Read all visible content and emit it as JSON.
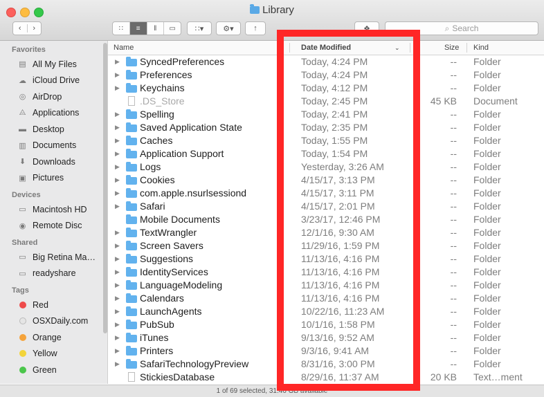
{
  "window": {
    "title": "Library"
  },
  "toolbar": {
    "search_placeholder": "Search",
    "view_icons": [
      "icon-view-icon",
      "list-view-icon",
      "column-view-icon",
      "cover-flow-icon"
    ]
  },
  "sidebar": {
    "sections": [
      {
        "title": "Favorites",
        "items": [
          {
            "label": "All My Files",
            "icon": "all-files-icon"
          },
          {
            "label": "iCloud Drive",
            "icon": "cloud-icon"
          },
          {
            "label": "AirDrop",
            "icon": "airdrop-icon"
          },
          {
            "label": "Applications",
            "icon": "applications-icon"
          },
          {
            "label": "Desktop",
            "icon": "desktop-icon"
          },
          {
            "label": "Documents",
            "icon": "documents-icon"
          },
          {
            "label": "Downloads",
            "icon": "downloads-icon"
          },
          {
            "label": "Pictures",
            "icon": "pictures-icon"
          }
        ]
      },
      {
        "title": "Devices",
        "items": [
          {
            "label": "Macintosh HD",
            "icon": "harddisk-icon"
          },
          {
            "label": "Remote Disc",
            "icon": "disc-icon"
          }
        ]
      },
      {
        "title": "Shared",
        "items": [
          {
            "label": "Big Retina Ma…",
            "icon": "display-icon"
          },
          {
            "label": "readyshare",
            "icon": "display-icon"
          }
        ]
      },
      {
        "title": "Tags",
        "items": [
          {
            "label": "Red",
            "color": "#ee4b4b"
          },
          {
            "label": "OSXDaily.com",
            "color": "#e5e5e5"
          },
          {
            "label": "Orange",
            "color": "#f5a33b"
          },
          {
            "label": "Yellow",
            "color": "#f3d43a"
          },
          {
            "label": "Green",
            "color": "#4bc64b"
          }
        ]
      }
    ]
  },
  "columns": {
    "name": "Name",
    "date": "Date Modified",
    "size": "Size",
    "kind": "Kind"
  },
  "files": [
    {
      "name": "SyncedPreferences",
      "date": "Today, 4:24 PM",
      "size": "--",
      "kind": "Folder",
      "folder": true,
      "expand": true
    },
    {
      "name": "Preferences",
      "date": "Today, 4:24 PM",
      "size": "--",
      "kind": "Folder",
      "folder": true,
      "expand": true
    },
    {
      "name": "Keychains",
      "date": "Today, 4:12 PM",
      "size": "--",
      "kind": "Folder",
      "folder": true,
      "expand": true
    },
    {
      "name": ".DS_Store",
      "date": "Today, 2:45 PM",
      "size": "45 KB",
      "kind": "Document",
      "folder": false,
      "expand": false,
      "dim": true
    },
    {
      "name": "Spelling",
      "date": "Today, 2:41 PM",
      "size": "--",
      "kind": "Folder",
      "folder": true,
      "expand": true
    },
    {
      "name": "Saved Application State",
      "date": "Today, 2:35 PM",
      "size": "--",
      "kind": "Folder",
      "folder": true,
      "expand": true
    },
    {
      "name": "Caches",
      "date": "Today, 1:55 PM",
      "size": "--",
      "kind": "Folder",
      "folder": true,
      "expand": true
    },
    {
      "name": "Application Support",
      "date": "Today, 1:54 PM",
      "size": "--",
      "kind": "Folder",
      "folder": true,
      "expand": true
    },
    {
      "name": "Logs",
      "date": "Yesterday, 3:26 AM",
      "size": "--",
      "kind": "Folder",
      "folder": true,
      "expand": true
    },
    {
      "name": "Cookies",
      "date": "4/15/17, 3:13 PM",
      "size": "--",
      "kind": "Folder",
      "folder": true,
      "expand": true
    },
    {
      "name": "com.apple.nsurlsessiond",
      "date": "4/15/17, 3:11 PM",
      "size": "--",
      "kind": "Folder",
      "folder": true,
      "expand": true
    },
    {
      "name": "Safari",
      "date": "4/15/17, 2:01 PM",
      "size": "--",
      "kind": "Folder",
      "folder": true,
      "expand": true
    },
    {
      "name": "Mobile Documents",
      "date": "3/23/17, 12:46 PM",
      "size": "--",
      "kind": "Folder",
      "folder": true,
      "expand": false
    },
    {
      "name": "TextWrangler",
      "date": "12/1/16, 9:30 AM",
      "size": "--",
      "kind": "Folder",
      "folder": true,
      "expand": true
    },
    {
      "name": "Screen Savers",
      "date": "11/29/16, 1:59 PM",
      "size": "--",
      "kind": "Folder",
      "folder": true,
      "expand": true
    },
    {
      "name": "Suggestions",
      "date": "11/13/16, 4:16 PM",
      "size": "--",
      "kind": "Folder",
      "folder": true,
      "expand": true
    },
    {
      "name": "IdentityServices",
      "date": "11/13/16, 4:16 PM",
      "size": "--",
      "kind": "Folder",
      "folder": true,
      "expand": true
    },
    {
      "name": "LanguageModeling",
      "date": "11/13/16, 4:16 PM",
      "size": "--",
      "kind": "Folder",
      "folder": true,
      "expand": true
    },
    {
      "name": "Calendars",
      "date": "11/13/16, 4:16 PM",
      "size": "--",
      "kind": "Folder",
      "folder": true,
      "expand": true
    },
    {
      "name": "LaunchAgents",
      "date": "10/22/16, 11:23 AM",
      "size": "--",
      "kind": "Folder",
      "folder": true,
      "expand": true
    },
    {
      "name": "PubSub",
      "date": "10/1/16, 1:58 PM",
      "size": "--",
      "kind": "Folder",
      "folder": true,
      "expand": true
    },
    {
      "name": "iTunes",
      "date": "9/13/16, 9:52 AM",
      "size": "--",
      "kind": "Folder",
      "folder": true,
      "expand": true
    },
    {
      "name": "Printers",
      "date": "9/3/16, 9:41 AM",
      "size": "--",
      "kind": "Folder",
      "folder": true,
      "expand": true
    },
    {
      "name": "SafariTechnologyPreview",
      "date": "8/31/16, 3:00 PM",
      "size": "--",
      "kind": "Folder",
      "folder": true,
      "expand": true
    },
    {
      "name": "StickiesDatabase",
      "date": "8/29/16, 11:37 AM",
      "size": "20 KB",
      "kind": "Text…ment",
      "folder": false,
      "expand": false
    }
  ],
  "status": {
    "text": "1 of 69 selected, 31.46 GB available"
  },
  "colors": {
    "highlight": "#ff2626",
    "folder": "#62b2ee"
  }
}
